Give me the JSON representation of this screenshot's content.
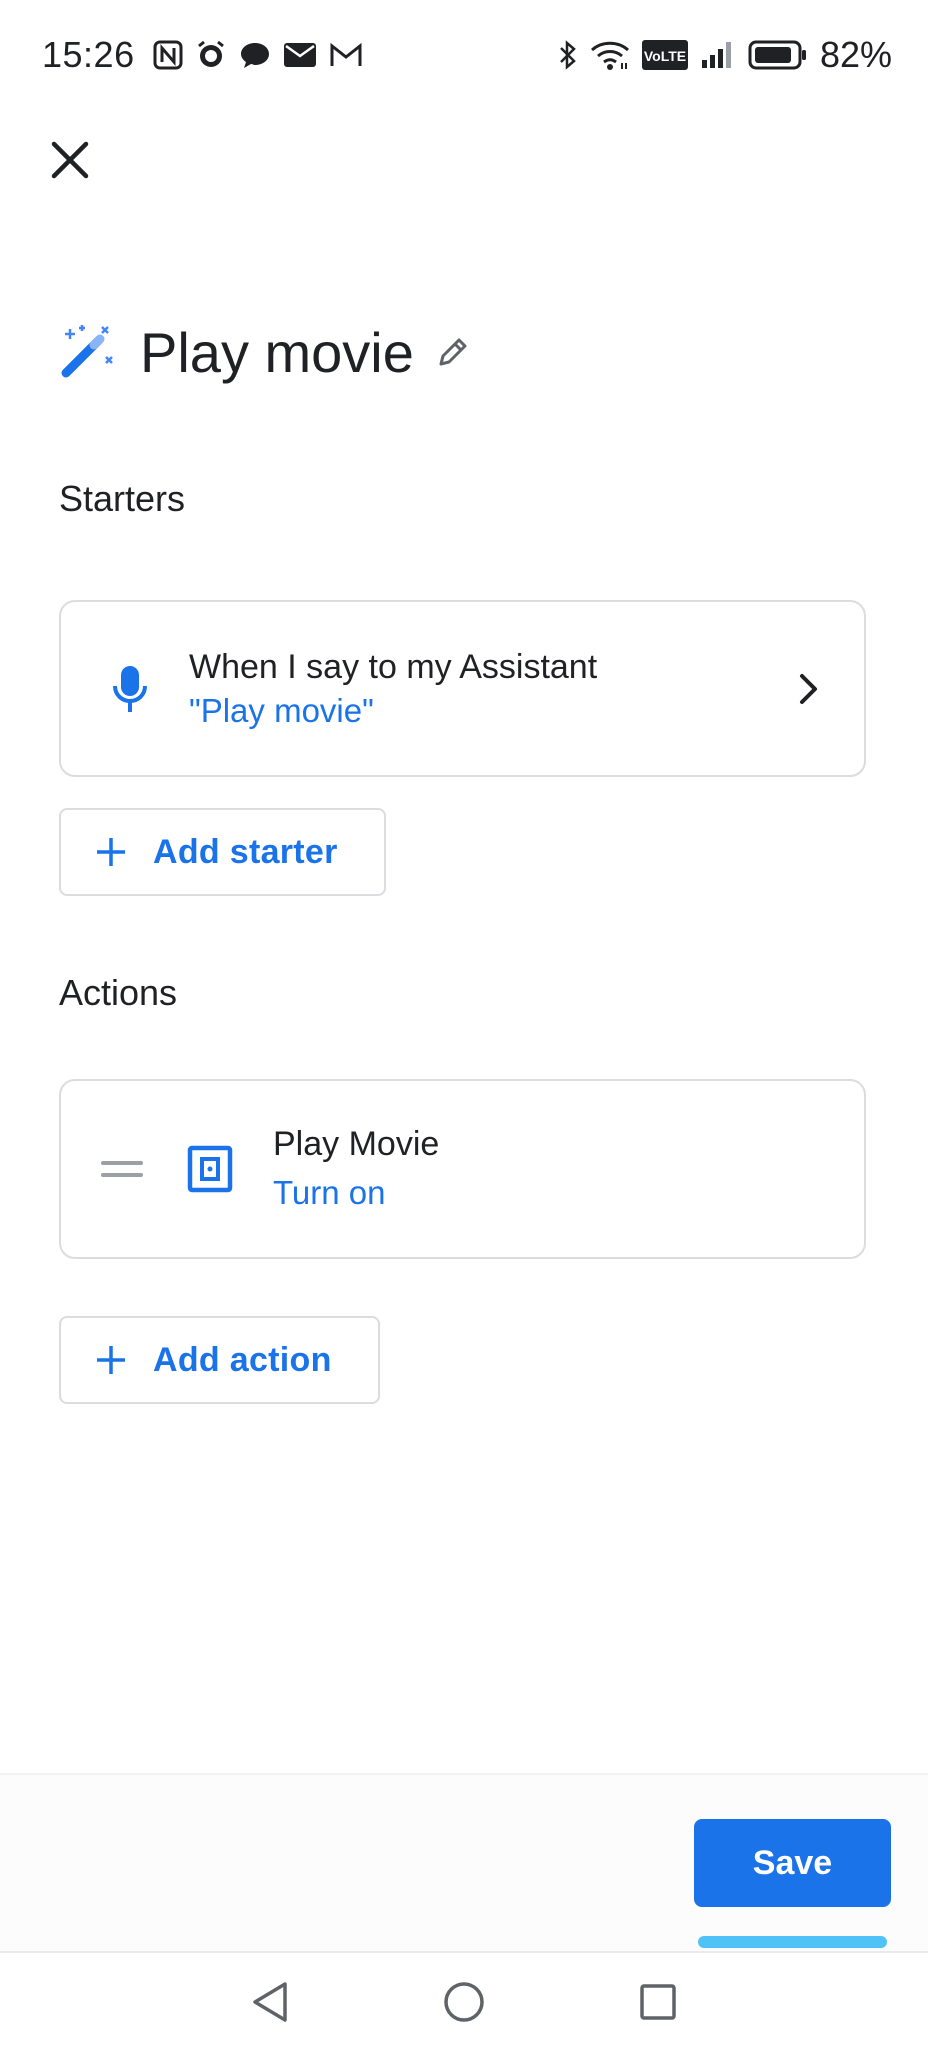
{
  "status_bar": {
    "time": "15:26",
    "battery_percent": "82%",
    "network_badge": "VoLTE",
    "left_icons": [
      "nfc-icon",
      "alarm-icon",
      "chat-bubble-icon",
      "email-icon",
      "gmail-icon"
    ],
    "right_icons": [
      "bluetooth-icon",
      "wifi-icon",
      "volte-icon",
      "signal-icon",
      "battery-icon"
    ]
  },
  "header": {
    "title": "Play movie",
    "icon": "magic-wand-icon"
  },
  "starters": {
    "section_label": "Starters",
    "items": [
      {
        "title": "When I say to my Assistant",
        "subtitle": "\"Play movie\"",
        "icon": "microphone-icon"
      }
    ],
    "add_label": "Add starter"
  },
  "actions": {
    "section_label": "Actions",
    "items": [
      {
        "title": "Play Movie",
        "subtitle": "Turn on",
        "icon": "device-icon"
      }
    ],
    "add_label": "Add action"
  },
  "footer": {
    "save_label": "Save"
  },
  "colors": {
    "accent": "#1a73e8",
    "text": "#202124",
    "border": "#dadce0",
    "save_underline": "#4fc3f7"
  }
}
